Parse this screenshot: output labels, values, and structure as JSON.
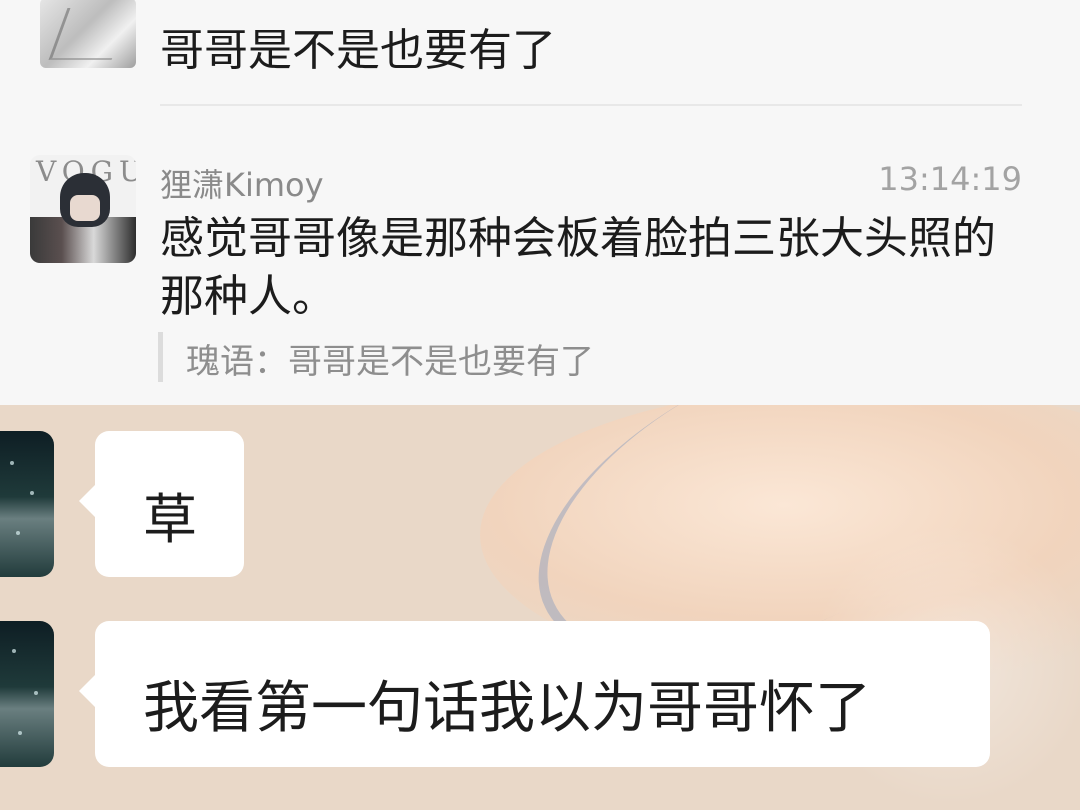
{
  "previous_message": {
    "text": "哥哥是不是也要有了"
  },
  "comment": {
    "username": "狸潇Kimoy",
    "time": "13:14:19",
    "text": "感觉哥哥像是那种会板着脸拍三张大头照的那种人。",
    "quote": "瑰语：哥哥是不是也要有了",
    "avatar_caption": "VOGUE"
  },
  "chat": {
    "messages": [
      {
        "text": "草"
      },
      {
        "text": "我看第一句话我以为哥哥怀了"
      }
    ]
  },
  "colors": {
    "page_bg": "#f7f7f7",
    "text_primary": "#1c1c1c",
    "text_secondary": "#8a8a8a",
    "bubble_bg": "#ffffff",
    "chat_wallpaper": "#e9d8c8"
  }
}
